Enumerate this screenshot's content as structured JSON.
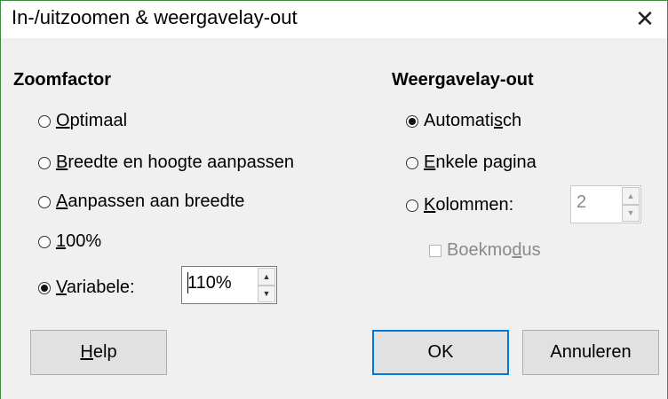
{
  "window": {
    "title": "In-/uitzoomen & weergavelay-out",
    "close_glyph": "✕"
  },
  "zoom": {
    "heading": "Zoomfactor",
    "options": [
      {
        "pre": "",
        "key": "O",
        "post": "ptimaal",
        "selected": false
      },
      {
        "pre": "",
        "key": "B",
        "post": "reedte en hoogte aanpassen",
        "selected": false
      },
      {
        "pre": "",
        "key": "A",
        "post": "anpassen aan breedte",
        "selected": false
      },
      {
        "pre": "",
        "key": "1",
        "post": "00%",
        "selected": false
      },
      {
        "pre": "",
        "key": "V",
        "post": "ariabele:",
        "selected": true
      }
    ],
    "variable_value": "110%"
  },
  "layout": {
    "heading": "Weergavelay-out",
    "options": [
      {
        "pre": "Automati",
        "key": "s",
        "post": "ch",
        "selected": true
      },
      {
        "pre": "",
        "key": "E",
        "post": "nkele pagina",
        "selected": false
      },
      {
        "pre": "",
        "key": "K",
        "post": "olommen:",
        "selected": false
      }
    ],
    "columns_value": "2",
    "bookmode": {
      "pre": "Boekmo",
      "key": "d",
      "post": "us",
      "checked": false,
      "enabled": false
    }
  },
  "buttons": {
    "help": {
      "pre": "",
      "key": "H",
      "post": "elp"
    },
    "ok": "OK",
    "cancel": "Annuleren"
  },
  "colors": {
    "accent": "#0078d7",
    "window_border": "#3c8d3c",
    "dialog_bg": "#f0f0f0"
  }
}
